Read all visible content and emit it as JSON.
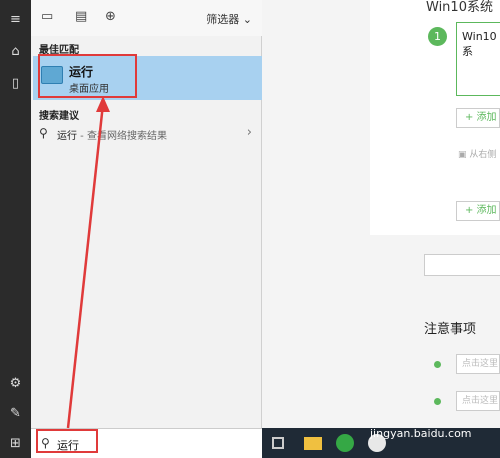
{
  "start_menu": {
    "filter_label": "筛选器",
    "best_match_header": "最佳匹配",
    "best_match_app": {
      "name": "运行",
      "type": "桌面应用"
    },
    "suggestions_header": "搜索建议",
    "suggestion": {
      "query": "运行",
      "action": " - 查看网络搜索结果"
    },
    "search_query": "运行"
  },
  "web_page": {
    "partial_title": "Win10系统",
    "step_number": "1",
    "step_text": "Win10系",
    "add_label": "+ 添加",
    "image_link": "从右侧",
    "notes_header": "注意事项",
    "note_placeholder": "点击这里"
  },
  "taskbar": {
    "watermark": "jingyan.baidu.com"
  },
  "colors": {
    "highlight": "#a8d1f0",
    "accent_green": "#5cb85c",
    "annotation_red": "#e03a3a"
  }
}
